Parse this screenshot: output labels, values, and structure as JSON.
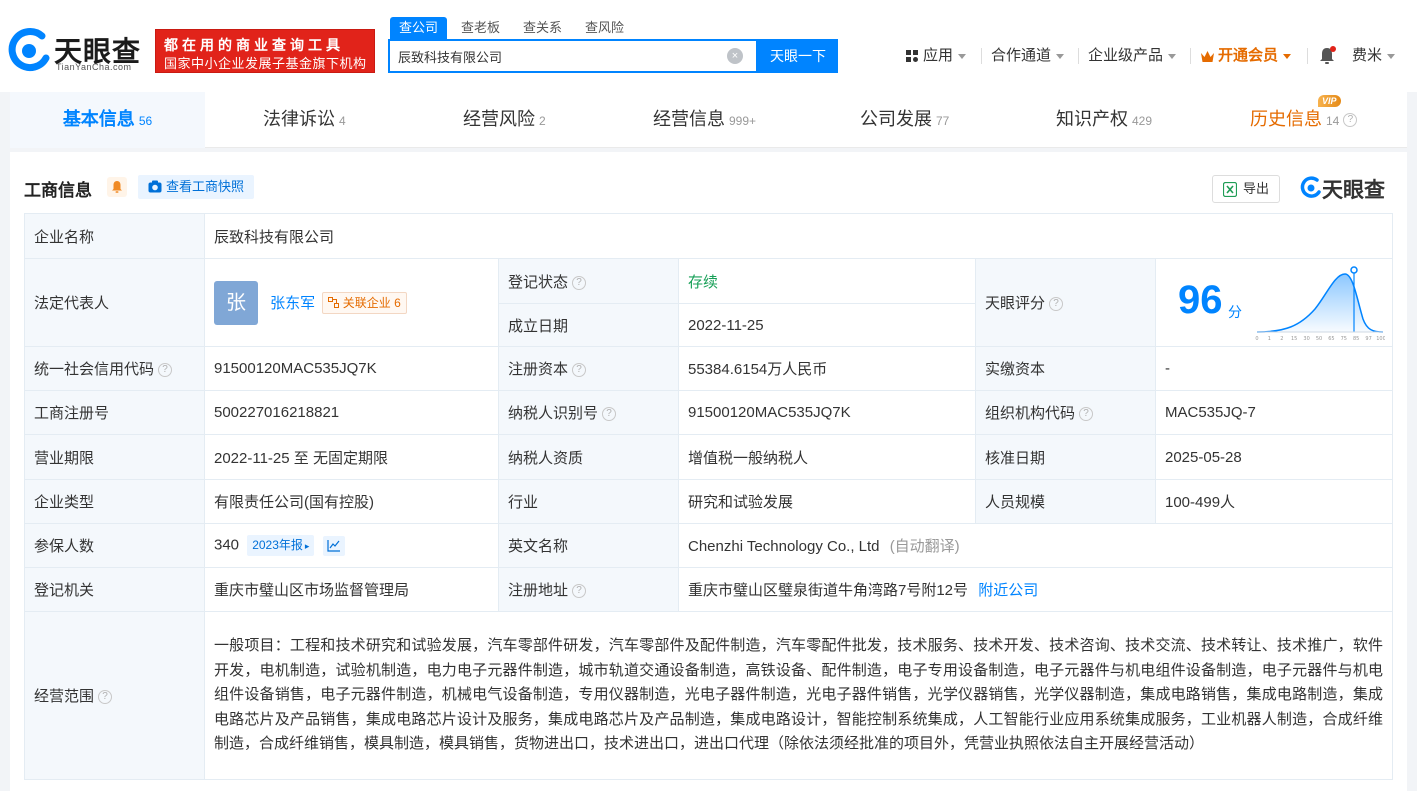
{
  "brand": {
    "name": "天眼查",
    "domain": "TianYanCha.com",
    "slogan_line1": "都在用的商业查询工具",
    "slogan_line2": "国家中小企业发展子基金旗下机构",
    "colors": {
      "primary": "#0084ff",
      "vip": "#e56b00",
      "slogan_bg": "#e1231a",
      "status_ok": "#18a058"
    }
  },
  "search": {
    "tabs": [
      "查公司",
      "查老板",
      "查关系",
      "查风险"
    ],
    "active_tab": "查公司",
    "value": "辰致科技有限公司",
    "button": "天眼一下"
  },
  "nav": {
    "apps": "应用",
    "partner": "合作通道",
    "enterprise": "企业级产品",
    "vip": "开通会员",
    "user": "费米"
  },
  "tabs": [
    {
      "label": "基本信息",
      "count": "56"
    },
    {
      "label": "法律诉讼",
      "count": "4"
    },
    {
      "label": "经营风险",
      "count": "2"
    },
    {
      "label": "经营信息",
      "count": "999+"
    },
    {
      "label": "公司发展",
      "count": "77"
    },
    {
      "label": "知识产权",
      "count": "429"
    },
    {
      "label": "历史信息",
      "count": "14",
      "badge": "VIP"
    }
  ],
  "section": {
    "title": "工商信息",
    "snapshot_btn": "查看工商快照",
    "export_btn": "导出",
    "watermark": "天眼查"
  },
  "company": {
    "name_label": "企业名称",
    "name": "辰致科技有限公司",
    "legal_rep_label": "法定代表人",
    "legal_rep_avatar": "张",
    "legal_rep": "张东军",
    "related_label": "关联企业",
    "related_count": "6",
    "reg_status_label": "登记状态",
    "reg_status": "存续",
    "est_date_label": "成立日期",
    "est_date": "2022-11-25",
    "score_label": "天眼评分",
    "score": "96",
    "score_unit": "分",
    "score_axis": [
      "0",
      "1",
      "2",
      "15",
      "30",
      "50",
      "65",
      "75",
      "85",
      "97",
      "100"
    ],
    "credit_code_label": "统一社会信用代码",
    "credit_code": "91500120MAC535JQ7K",
    "reg_capital_label": "注册资本",
    "reg_capital": "55384.6154万人民币",
    "paid_capital_label": "实缴资本",
    "paid_capital": "-",
    "reg_no_label": "工商注册号",
    "reg_no": "500227016218821",
    "taxpayer_id_label": "纳税人识别号",
    "taxpayer_id": "91500120MAC535JQ7K",
    "org_code_label": "组织机构代码",
    "org_code": "MAC535JQ-7",
    "term_label": "营业期限",
    "term": "2022-11-25 至 无固定期限",
    "taxpayer_quality_label": "纳税人资质",
    "taxpayer_quality": "增值税一般纳税人",
    "approval_date_label": "核准日期",
    "approval_date": "2025-05-28",
    "type_label": "企业类型",
    "type": "有限责任公司(国有控股)",
    "industry_label": "行业",
    "industry": "研究和试验发展",
    "staff_size_label": "人员规模",
    "staff_size": "100-499人",
    "insured_label": "参保人数",
    "insured": "340",
    "insured_report": "2023年报",
    "english_name_label": "英文名称",
    "english_name": "Chenzhi Technology Co., Ltd",
    "auto_translate": "(自动翻译)",
    "authority_label": "登记机关",
    "authority": "重庆市璧山区市场监督管理局",
    "address_label": "注册地址",
    "address": "重庆市璧山区璧泉街道牛角湾路7号附12号",
    "nearby": "附近公司",
    "scope_label": "经营范围",
    "scope": "一般项目：工程和技术研究和试验发展，汽车零部件研发，汽车零部件及配件制造，汽车零配件批发，技术服务、技术开发、技术咨询、技术交流、技术转让、技术推广，软件开发，电机制造，试验机制造，电力电子元器件制造，城市轨道交通设备制造，高铁设备、配件制造，电子专用设备制造，电子元器件与机电组件设备制造，电子元器件与机电组件设备销售，电子元器件制造，机械电气设备制造，专用仪器制造，光电子器件制造，光电子器件销售，光学仪器销售，光学仪器制造，集成电路销售，集成电路制造，集成电路芯片及产品销售，集成电路芯片设计及服务，集成电路芯片及产品制造，集成电路设计，智能控制系统集成，人工智能行业应用系统集成服务，工业机器人制造，合成纤维制造，合成纤维销售，模具制造，模具销售，货物进出口，技术进出口，进出口代理（除依法须经批准的项目外，凭营业执照依法自主开展经营活动）"
  }
}
